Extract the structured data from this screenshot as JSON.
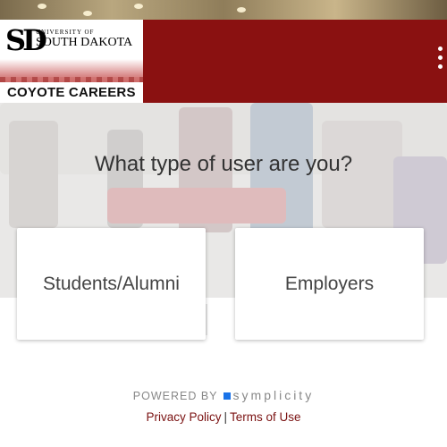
{
  "header": {
    "logo_mark": "SD",
    "university_of": "UNIVERSITY OF",
    "university_name": "SOUTH DAKOTA",
    "careers_title": "COYOTE CAREERS",
    "brand_color": "#8a1111"
  },
  "hero": {
    "question": "What type of user are you?"
  },
  "cards": {
    "students_label": "Students/Alumni",
    "employers_label": "Employers"
  },
  "footer": {
    "powered_by": "POWERED BY",
    "brand": "symplicity",
    "privacy": "Privacy Policy",
    "separator": "|",
    "terms": "Terms of Use"
  }
}
